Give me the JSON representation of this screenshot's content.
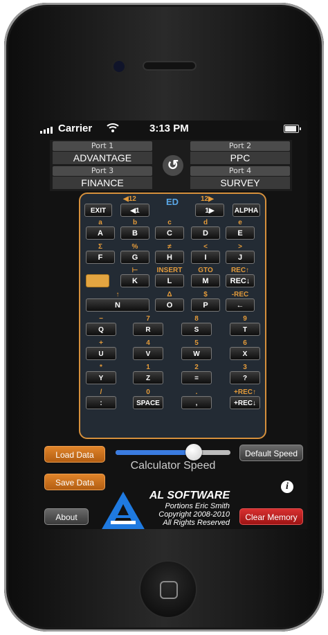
{
  "status_bar": {
    "carrier": "Carrier",
    "time": "3:13 PM"
  },
  "ports": [
    {
      "label": "Port 1",
      "value": "ADVANTAGE"
    },
    {
      "label": "Port 2",
      "value": "PPC"
    },
    {
      "label": "Port 3",
      "value": "FINANCE"
    },
    {
      "label": "Port 4",
      "value": "SURVEY"
    }
  ],
  "calc": {
    "top_labels": {
      "left12": "◀12",
      "ed": "ED",
      "right12": "12▶"
    },
    "row0": {
      "exit": "EXIT",
      "left1": "◀1",
      "right1": "1▶",
      "alpha": "ALPHA"
    },
    "row1_labels": [
      "a",
      "b",
      "c",
      "d",
      "e"
    ],
    "row1_keys": [
      "A",
      "B",
      "C",
      "D",
      "E"
    ],
    "row2_labels": [
      "Σ",
      "%",
      "≠",
      "<",
      ">"
    ],
    "row2_keys": [
      "F",
      "G",
      "H",
      "I",
      "J"
    ],
    "row3_labels": [
      "⊢",
      "INSERT",
      "GTO",
      "REC↑"
    ],
    "row3_keys": [
      "K",
      "L",
      "M",
      "REC↓"
    ],
    "row4_labels": [
      "↑",
      "Δ",
      "$",
      "-REC"
    ],
    "row4_keys": [
      "N",
      "O",
      "P",
      "←"
    ],
    "row5_labels": [
      "−",
      "7",
      "8",
      "9"
    ],
    "row5_keys": [
      "Q",
      "R",
      "S",
      "T"
    ],
    "row6_labels": [
      "+",
      "4",
      "5",
      "6"
    ],
    "row6_keys": [
      "U",
      "V",
      "W",
      "X"
    ],
    "row7_labels": [
      "*",
      "1",
      "2",
      "3"
    ],
    "row7_keys": [
      "Y",
      "Z",
      "=",
      "?"
    ],
    "row8_labels": [
      "/",
      "0",
      ".",
      "+REC↑"
    ],
    "row8_keys": [
      ":",
      "SPACE",
      ",",
      "+REC↓"
    ]
  },
  "controls": {
    "load_data": "Load Data",
    "save_data": "Save Data",
    "about": "About",
    "default_speed": "Default Speed",
    "clear_memory": "Clear Memory",
    "speed_label": "Calculator Speed",
    "speed_value": 0.68
  },
  "logo": {
    "title": "AL SOFTWARE",
    "line1": "Portions Eric Smith",
    "line2": "Copyright 2008-2010",
    "line3": "All Rights Reserved"
  }
}
